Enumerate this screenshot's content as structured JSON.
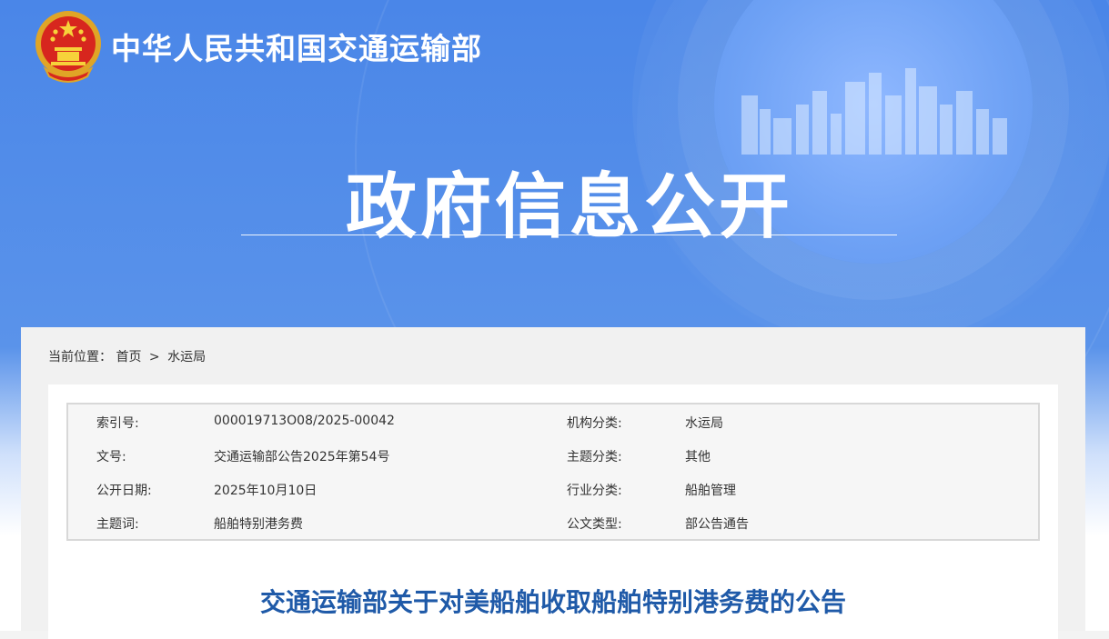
{
  "header": {
    "site_title": "中华人民共和国交通运输部",
    "section_title": "政府信息公开",
    "emblem_icon": "national-emblem-icon"
  },
  "breadcrumb": {
    "label": "当前位置：",
    "items": [
      "首页",
      "水运局"
    ],
    "separator": ">"
  },
  "meta": {
    "rows": [
      {
        "k1": "索引号:",
        "v1": "000019713O08/2025-00042",
        "k2": "机构分类:",
        "v2": "水运局"
      },
      {
        "k1": "文号:",
        "v1": "交通运输部公告2025年第54号",
        "k2": "主题分类:",
        "v2": "其他"
      },
      {
        "k1": "公开日期:",
        "v1": "2025年10月10日",
        "k2": "行业分类:",
        "v2": "船舶管理"
      },
      {
        "k1": "主题词:",
        "v1": "船舶特别港务费",
        "k2": "公文类型:",
        "v2": "部公告通告"
      }
    ]
  },
  "document": {
    "title": "交通运输部关于对美船舶收取船舶特别港务费的公告"
  },
  "colors": {
    "banner_blue": "#4a86e8",
    "title_blue": "#1f5aa8"
  }
}
